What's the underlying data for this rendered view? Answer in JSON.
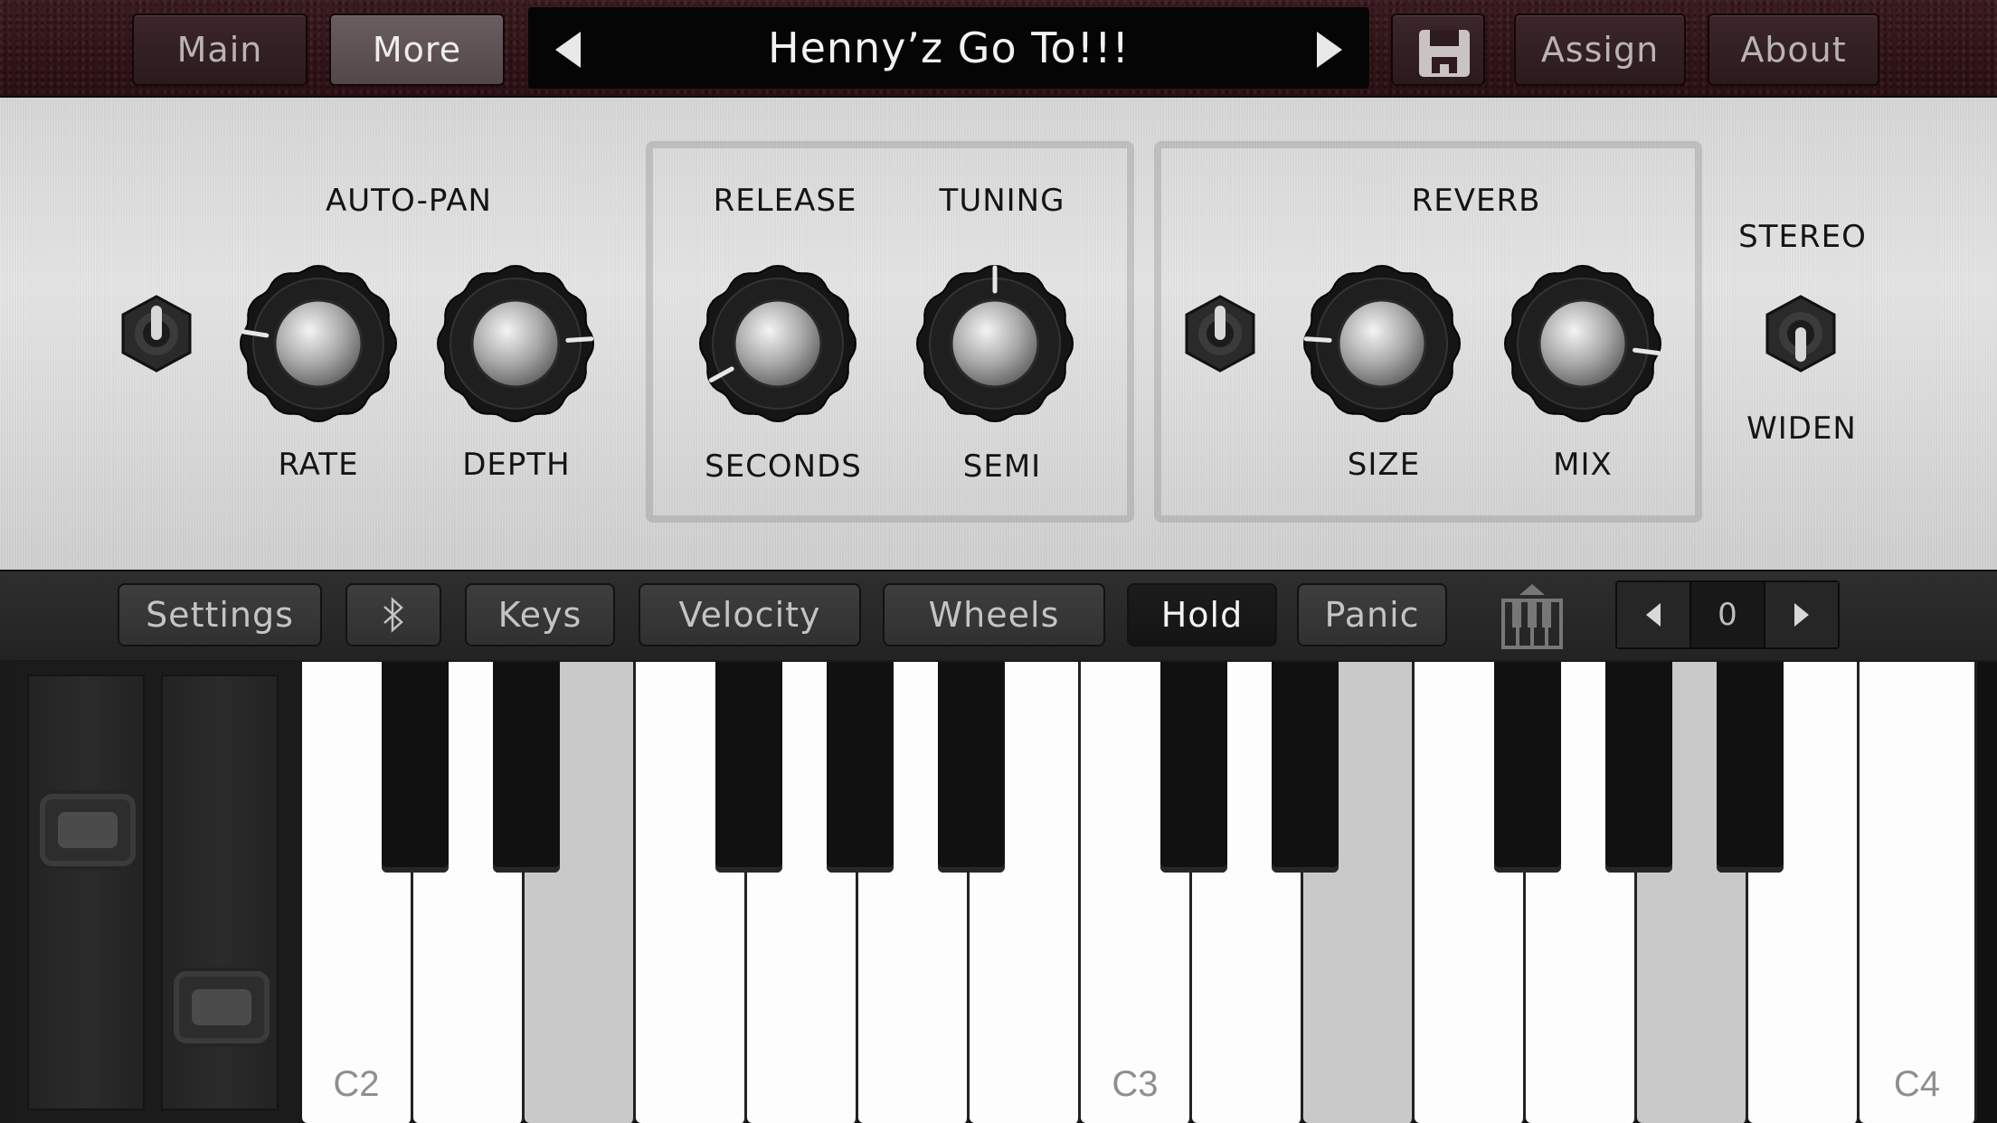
{
  "topbar": {
    "main_label": "Main",
    "more_label": "More",
    "preset_name": "Henny’z Go To!!!",
    "assign_label": "Assign",
    "about_label": "About",
    "active_tab": "More",
    "icons": [
      "prev-preset-arrow-icon",
      "next-preset-arrow-icon",
      "save-icon"
    ]
  },
  "panel": {
    "autopan": {
      "title": "AUTO-PAN",
      "rate_label": "RATE",
      "depth_label": "DEPTH"
    },
    "release": {
      "title": "RELEASE",
      "label": "SECONDS"
    },
    "tuning": {
      "title": "TUNING",
      "label": "SEMI"
    },
    "reverb": {
      "title": "REVERB",
      "size_label": "SIZE",
      "mix_label": "MIX"
    },
    "stereo": {
      "title": "STEREO",
      "label": "WIDEN"
    },
    "knob_values": {
      "rate": 0.2,
      "depth": 0.82,
      "release": 0.06,
      "tuning": 0.5,
      "size": 0.18,
      "mix": 0.86
    }
  },
  "strip": {
    "settings_label": "Settings",
    "bluetooth_label": "ᛒ",
    "keys_label": "Keys",
    "velocity_label": "Velocity",
    "wheels_label": "Wheels",
    "hold_label": "Hold",
    "panic_label": "Panic",
    "hold_active": true,
    "octave_value": "0",
    "icons": [
      "bluetooth-icon",
      "piano-layout-icon",
      "octave-down-icon",
      "octave-up-icon"
    ]
  },
  "keyboard": {
    "labels": {
      "c2": "C2",
      "c3": "C3",
      "c4": "C4"
    },
    "held_keys": [
      "E2",
      "A3",
      "D4"
    ]
  },
  "colors": {
    "topbar_bg": "#3c1c20",
    "active_topbtn": "#6a5d60",
    "panel_bg": "#dcdcdc",
    "strip_bg": "#2a2a2a",
    "held_key": "#c9c9c9"
  }
}
